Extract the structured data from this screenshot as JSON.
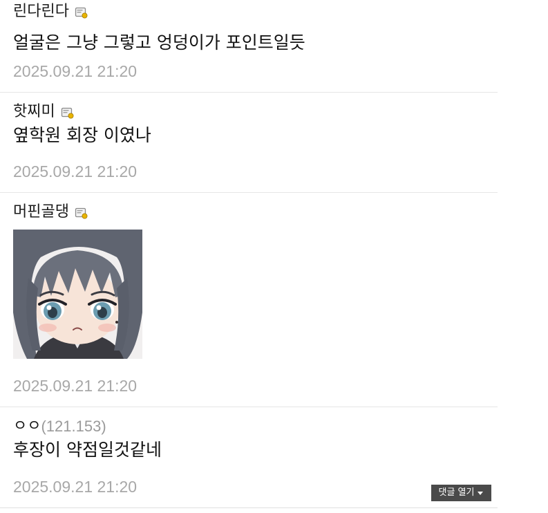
{
  "comments": [
    {
      "nickname": "린다린다",
      "has_member_icon": true,
      "text": "얼굴은 그냥 그렇고 엉덩이가 포인트일듯",
      "date": "2025.09.21 21:20"
    },
    {
      "nickname": "핫찌미",
      "has_member_icon": true,
      "text": "옆학원 회장 이였나",
      "date": "2025.09.21 21:20"
    },
    {
      "nickname": "머핀골댕",
      "has_member_icon": true,
      "dccon": "anime-girl-sticker",
      "date": "2025.09.21 21:20"
    },
    {
      "nickname": "ㅇㅇ",
      "ip": "(121.153)",
      "text": "후장이 약점일것같네",
      "date": "2025.09.21 21:20"
    }
  ],
  "open_comments_button": {
    "label": "댓글 열기",
    "icon": "caret-down-icon"
  },
  "colors": {
    "date": "#a8a8a8",
    "ip": "#9a9a9a",
    "divider": "#e6e6e6",
    "button_bg": "#4a4a4a"
  }
}
